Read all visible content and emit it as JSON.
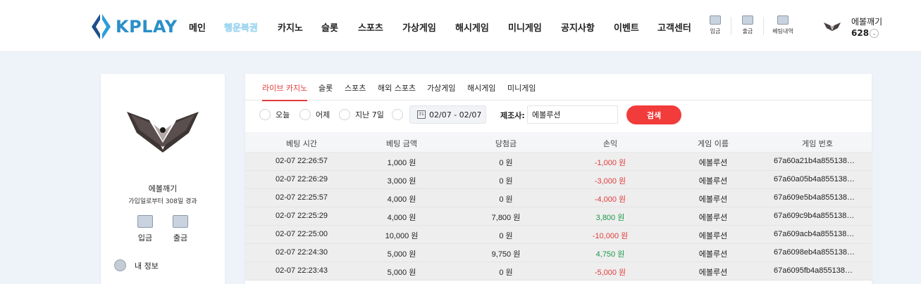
{
  "brand": {
    "logo_text": "KPLAY"
  },
  "nav": [
    {
      "label": "메인",
      "highlight": false
    },
    {
      "label": "행운복권",
      "highlight": true
    },
    {
      "label": "카지노",
      "highlight": false
    },
    {
      "label": "슬롯",
      "highlight": false
    },
    {
      "label": "스포츠",
      "highlight": false
    },
    {
      "label": "가상게임",
      "highlight": false
    },
    {
      "label": "해시게임",
      "highlight": false
    },
    {
      "label": "미니게임",
      "highlight": false
    },
    {
      "label": "공지사항",
      "highlight": false
    },
    {
      "label": "이벤트",
      "highlight": false
    },
    {
      "label": "고객센터",
      "highlight": false
    }
  ],
  "header_icons": [
    {
      "label": "입금",
      "icon": "deposit-icon"
    },
    {
      "label": "출금",
      "icon": "withdraw-icon"
    },
    {
      "label": "베팅내역",
      "icon": "betting-history-icon"
    }
  ],
  "user": {
    "name": "에볼깨기",
    "points": "628"
  },
  "sidebar": {
    "name": "에볼깨기",
    "since": "가입일로부터 308일 경과",
    "deposit": "입금",
    "withdraw": "출금",
    "my_info": "내 정보"
  },
  "tabs": [
    "라이브 카지노",
    "슬롯",
    "스포츠",
    "해외 스포츠",
    "가상게임",
    "해시게임",
    "미니게임"
  ],
  "filters": {
    "today": "오늘",
    "yesterday": "어제",
    "last7": "지난 7일",
    "date_range": "02/07 - 02/07",
    "calendar_digit": "31",
    "provider_label": "제조사:",
    "provider_value": "에볼루션",
    "search": "검색"
  },
  "table": {
    "headers": [
      "베팅 시간",
      "베팅 금액",
      "당첨금",
      "손익",
      "게임 이름",
      "게임 번호"
    ],
    "rows": [
      {
        "time": "02-07 22:26:57",
        "bet": "1,000 원",
        "win": "0 원",
        "pl": "-1,000 원",
        "sign": "neg",
        "game": "에볼루션",
        "id": "67a60a21b4a855138…"
      },
      {
        "time": "02-07 22:26:29",
        "bet": "3,000 원",
        "win": "0 원",
        "pl": "-3,000 원",
        "sign": "neg",
        "game": "에볼루션",
        "id": "67a60a05b4a855138…"
      },
      {
        "time": "02-07 22:25:57",
        "bet": "4,000 원",
        "win": "0 원",
        "pl": "-4,000 원",
        "sign": "neg",
        "game": "에볼루션",
        "id": "67a609e5b4a855138…"
      },
      {
        "time": "02-07 22:25:29",
        "bet": "4,000 원",
        "win": "7,800 원",
        "pl": "3,800 원",
        "sign": "pos",
        "game": "에볼루션",
        "id": "67a609c9b4a855138…"
      },
      {
        "time": "02-07 22:25:00",
        "bet": "10,000 원",
        "win": "0 원",
        "pl": "-10,000 원",
        "sign": "neg",
        "game": "에볼루션",
        "id": "67a609acb4a855138…"
      },
      {
        "time": "02-07 22:24:30",
        "bet": "5,000 원",
        "win": "9,750 원",
        "pl": "4,750 원",
        "sign": "pos",
        "game": "에볼루션",
        "id": "67a6098eb4a855138…"
      },
      {
        "time": "02-07 22:23:43",
        "bet": "5,000 원",
        "win": "0 원",
        "pl": "-5,000 원",
        "sign": "neg",
        "game": "에볼루션",
        "id": "67a6095fb4a855138…"
      }
    ]
  },
  "colors": {
    "accent": "#e23b3b",
    "brand": "#2a8fc9",
    "positive": "#1a9a4a"
  }
}
